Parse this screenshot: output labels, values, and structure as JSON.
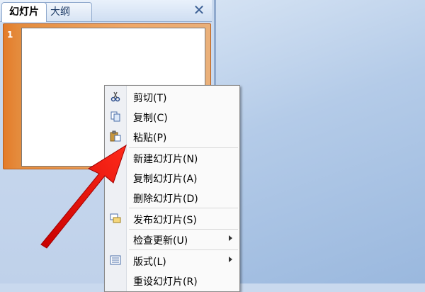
{
  "pane": {
    "tabs": [
      {
        "label": "幻灯片"
      },
      {
        "label": "大纲"
      }
    ],
    "close_glyph": "✕"
  },
  "slides": [
    {
      "number": "1"
    }
  ],
  "context_menu": {
    "items": [
      {
        "label": "剪切(T)",
        "icon": "scissors-icon"
      },
      {
        "label": "复制(C)",
        "icon": "copy-icon"
      },
      {
        "label": "粘贴(P)",
        "icon": "paste-icon"
      },
      {
        "label": "新建幻灯片(N)",
        "icon": ""
      },
      {
        "label": "复制幻灯片(A)",
        "icon": ""
      },
      {
        "label": "删除幻灯片(D)",
        "icon": ""
      },
      {
        "label": "发布幻灯片(S)",
        "icon": "publish-icon"
      },
      {
        "label": "检查更新(U)",
        "icon": "",
        "submenu": true
      },
      {
        "label": "版式(L)",
        "icon": "layout-icon",
        "submenu": true
      },
      {
        "label": "重设幻灯片(R)",
        "icon": ""
      }
    ]
  },
  "colors": {
    "accent_orange": "#e48b3c",
    "pane_blue": "#cddcf0",
    "annotation_arrow": "#e01515"
  }
}
